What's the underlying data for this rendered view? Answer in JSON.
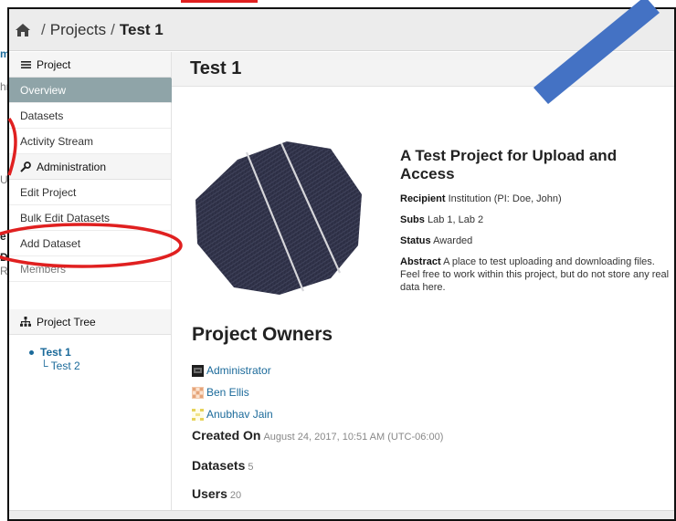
{
  "background": {
    "partial_texts": [
      "m",
      "hn",
      "Up",
      "e",
      "D",
      "Re"
    ]
  },
  "breadcrumb": {
    "items": [
      {
        "label": "Projects"
      },
      {
        "label": "Test 1"
      }
    ],
    "separator": "/"
  },
  "sidebar": {
    "project_header": "Project",
    "items": [
      {
        "label": "Overview"
      },
      {
        "label": "Datasets"
      },
      {
        "label": "Activity Stream"
      }
    ],
    "admin_header": "Administration",
    "admin_items": [
      {
        "label": "Edit Project"
      },
      {
        "label": "Bulk Edit Datasets"
      },
      {
        "label": "Add Dataset"
      },
      {
        "label": "Members"
      }
    ],
    "tree_header": "Project Tree",
    "tree": {
      "root": "Test 1",
      "child_prefix": "└",
      "child": "Test 2"
    }
  },
  "main": {
    "title": "Test 1",
    "project_title": "A Test Project for Upload and Access",
    "recipient_label": "Recipient",
    "recipient_value": "Institution (PI: Doe, John)",
    "subs_label": "Subs",
    "subs_value": "Lab 1, Lab 2",
    "status_label": "Status",
    "status_value": "Awarded",
    "abstract_label": "Abstract",
    "abstract_value": "A place to test uploading and downloading files. Feel free to work within this project, but do not store any real data here.",
    "owners_heading": "Project Owners",
    "owners": [
      {
        "name": "Administrator"
      },
      {
        "name": "Ben Ellis"
      },
      {
        "name": "Anubhav Jain"
      }
    ],
    "created_label": "Created On",
    "created_value": "August 24, 2017, 10:51 AM (UTC-06:00)",
    "datasets_label": "Datasets",
    "datasets_count": "5",
    "users_label": "Users",
    "users_count": "20"
  },
  "colors": {
    "active_nav": "#8fa4a8",
    "link": "#1b6a9a",
    "annotation_red": "#e02020",
    "annotation_arrow": "#4472c4"
  }
}
